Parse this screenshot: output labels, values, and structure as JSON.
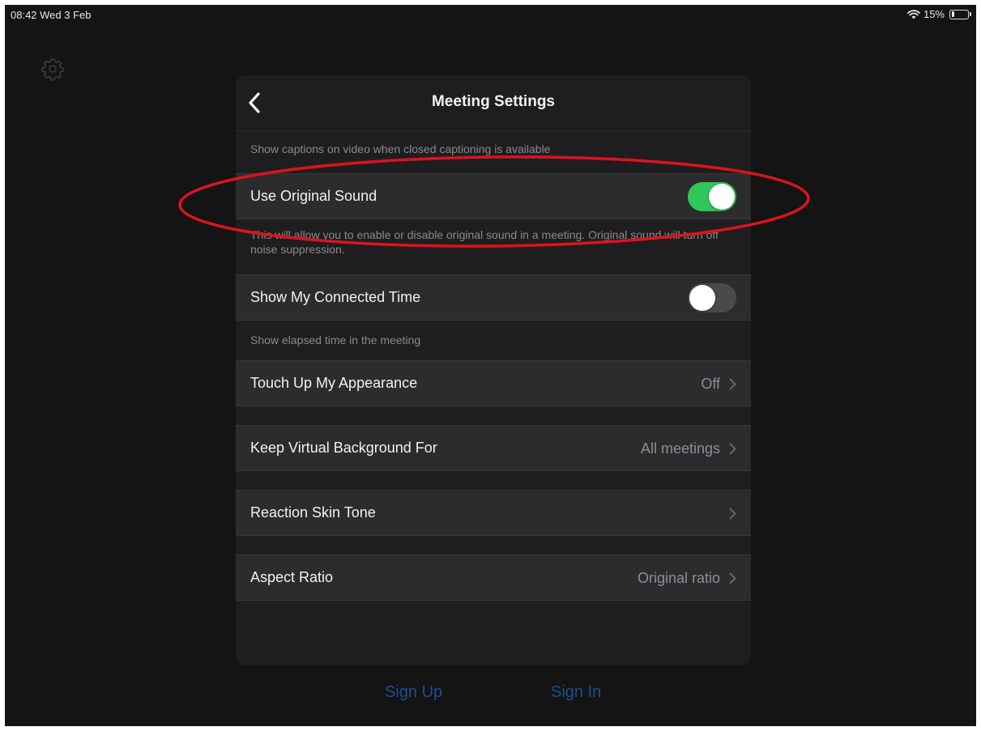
{
  "status_bar": {
    "time_date": "08:42  Wed 3 Feb",
    "battery_text": "15%",
    "battery_level": 0.15
  },
  "background": {
    "settings_icon": "gear-icon",
    "sign_up_label": "Sign Up",
    "sign_in_label": "Sign In"
  },
  "panel": {
    "title": "Meeting Settings",
    "back_icon": "chevron-left-icon",
    "caption_description": "Show captions on video when closed captioning is available",
    "settings": [
      {
        "label": "Use Original Sound",
        "control": "toggle",
        "enabled": true,
        "description": "This will allow you to enable or disable original sound in a meeting. Original sound will turn off noise suppression."
      },
      {
        "label": "Show My Connected Time",
        "control": "toggle",
        "enabled": false,
        "description": "Show elapsed time in the meeting"
      },
      {
        "label": "Touch Up My Appearance",
        "control": "disclosure",
        "value": "Off"
      },
      {
        "label": "Keep Virtual Background For",
        "control": "disclosure",
        "value": "All meetings"
      },
      {
        "label": "Reaction Skin Tone",
        "control": "disclosure",
        "value": ""
      },
      {
        "label": "Aspect Ratio",
        "control": "disclosure",
        "value": "Original ratio"
      }
    ]
  },
  "colors": {
    "toggle_on": "#30c75a",
    "toggle_off": "#4a4a4d",
    "annotation": "#e0111f",
    "link": "#1d4f8f"
  },
  "annotation": {
    "shape": "ellipse",
    "highlights": "Use Original Sound"
  }
}
